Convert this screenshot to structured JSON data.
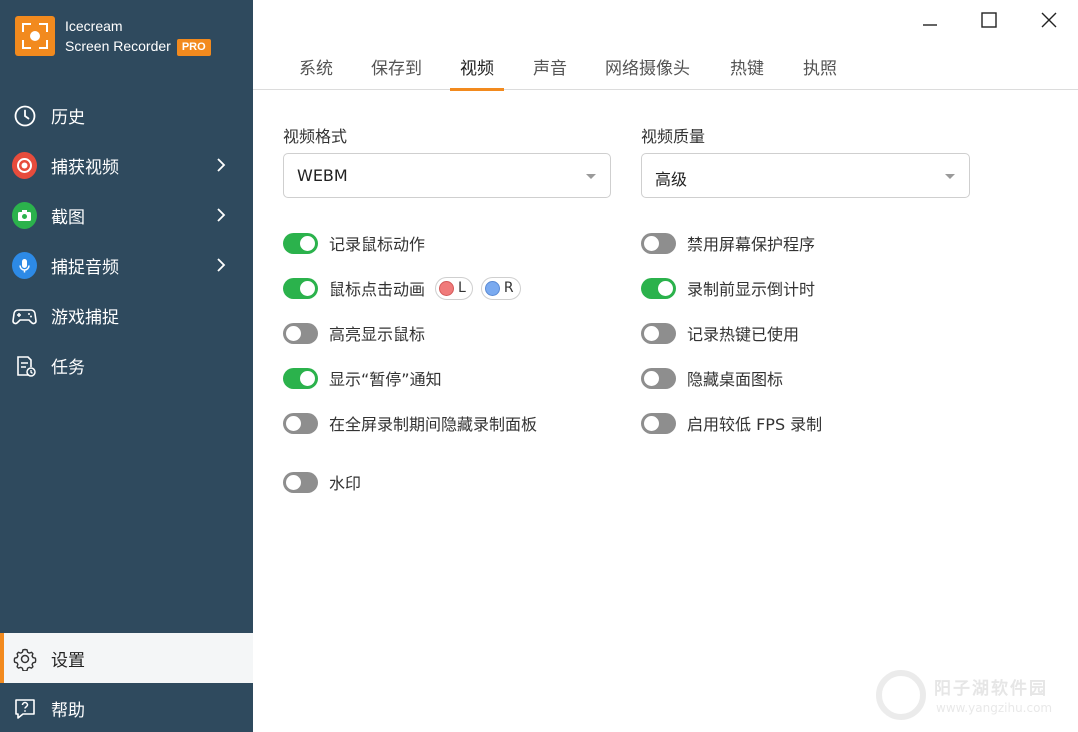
{
  "app": {
    "name_line1": "Icecream",
    "name_line2": "Screen Recorder",
    "badge": "PRO",
    "accent": "#f28a1e",
    "sidebar_bg": "#2f4a5e"
  },
  "sidebar": {
    "items": [
      {
        "label": "历史",
        "icon": "clock-icon",
        "has_arrow": false
      },
      {
        "label": "捕获视频",
        "icon": "record-icon",
        "has_arrow": true,
        "color": "#e74c3c"
      },
      {
        "label": "截图",
        "icon": "camera-icon",
        "has_arrow": true,
        "color": "#2bb24c"
      },
      {
        "label": "捕捉音频",
        "icon": "microphone-icon",
        "has_arrow": true,
        "color": "#2d8ae6"
      },
      {
        "label": "游戏捕捉",
        "icon": "gamepad-icon",
        "has_arrow": false
      },
      {
        "label": "任务",
        "icon": "task-icon",
        "has_arrow": false
      },
      {
        "label": "设置",
        "icon": "gear-icon",
        "has_arrow": false,
        "active": true
      },
      {
        "label": "帮助",
        "icon": "help-icon",
        "has_arrow": false
      }
    ]
  },
  "tabs": [
    {
      "label": "系统"
    },
    {
      "label": "保存到"
    },
    {
      "label": "视频",
      "active": true
    },
    {
      "label": "声音"
    },
    {
      "label": "网络摄像头"
    },
    {
      "label": "热键"
    },
    {
      "label": "执照"
    }
  ],
  "video": {
    "format_label": "视频格式",
    "format_value": "WEBM",
    "quality_label": "视频质量",
    "quality_value": "高级"
  },
  "options_left": [
    {
      "label": "记录鼠标动作",
      "on": true
    },
    {
      "label": "鼠标点击动画",
      "on": true
    },
    {
      "label": "高亮显示鼠标",
      "on": false
    },
    {
      "label": "显示“暂停”通知",
      "on": true
    },
    {
      "label": "在全屏录制期间隐藏录制面板",
      "on": false
    }
  ],
  "options_right": [
    {
      "label": "禁用屏幕保护程序",
      "on": false
    },
    {
      "label": "录制前显示倒计时",
      "on": true
    },
    {
      "label": "记录热键已使用",
      "on": false
    },
    {
      "label": "隐藏桌面图标",
      "on": false
    },
    {
      "label": "启用较低 FPS 录制",
      "on": false
    }
  ],
  "click_buttons": {
    "left": {
      "label": "L",
      "color": "#f07a7a"
    },
    "right": {
      "label": "R",
      "color": "#7aaaf0"
    }
  },
  "watermark_option": {
    "label": "水印",
    "on": false
  },
  "site_watermark": {
    "line1": "阳子湖软件园",
    "line2": "www.yangzihu.com"
  }
}
